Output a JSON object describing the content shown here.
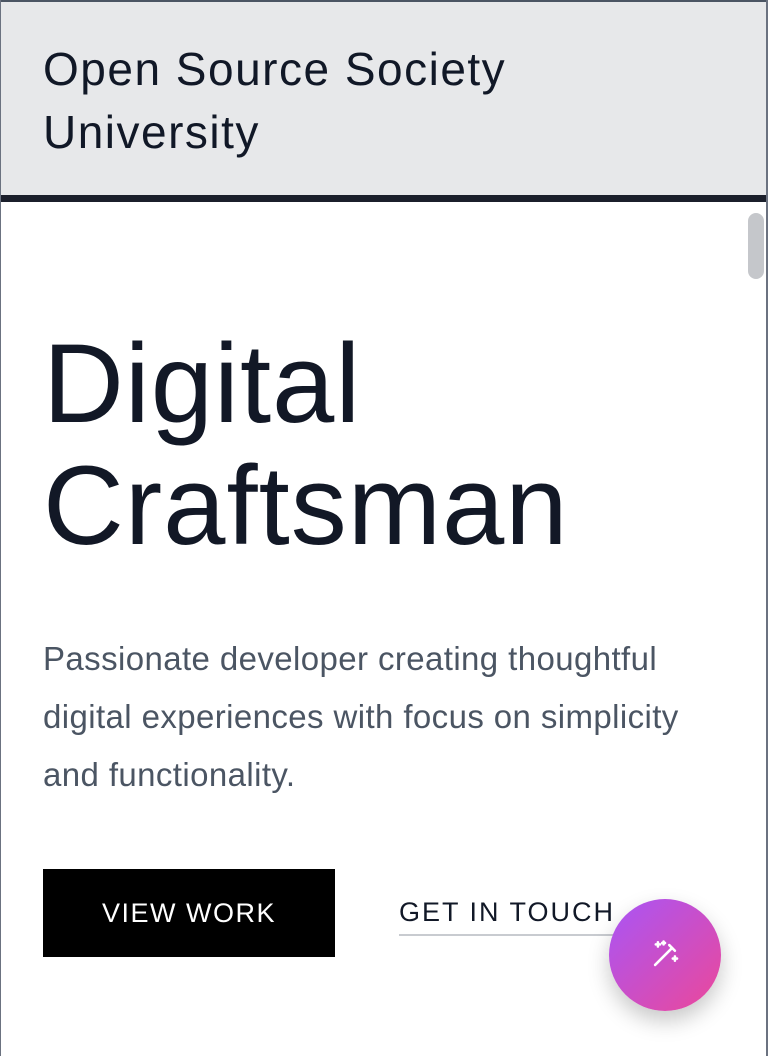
{
  "header": {
    "brand": "Open Source Society University"
  },
  "hero": {
    "title_line1": "Digital",
    "title_line2": "Craftsman",
    "description": "Passionate developer creating thoughtful digital experiences with focus on simplicity and functionality."
  },
  "actions": {
    "primary_label": "VIEW WORK",
    "secondary_label": "GET IN TOUCH"
  },
  "fab": {
    "icon": "magic-wand-icon"
  },
  "colors": {
    "header_bg": "#e7e8ea",
    "header_rule": "#1b1f2b",
    "text_dark": "#121826",
    "text_muted": "#4b5563",
    "primary_button_bg": "#000000",
    "fab_gradient_start": "#a855f7",
    "fab_gradient_end": "#ec4899"
  }
}
